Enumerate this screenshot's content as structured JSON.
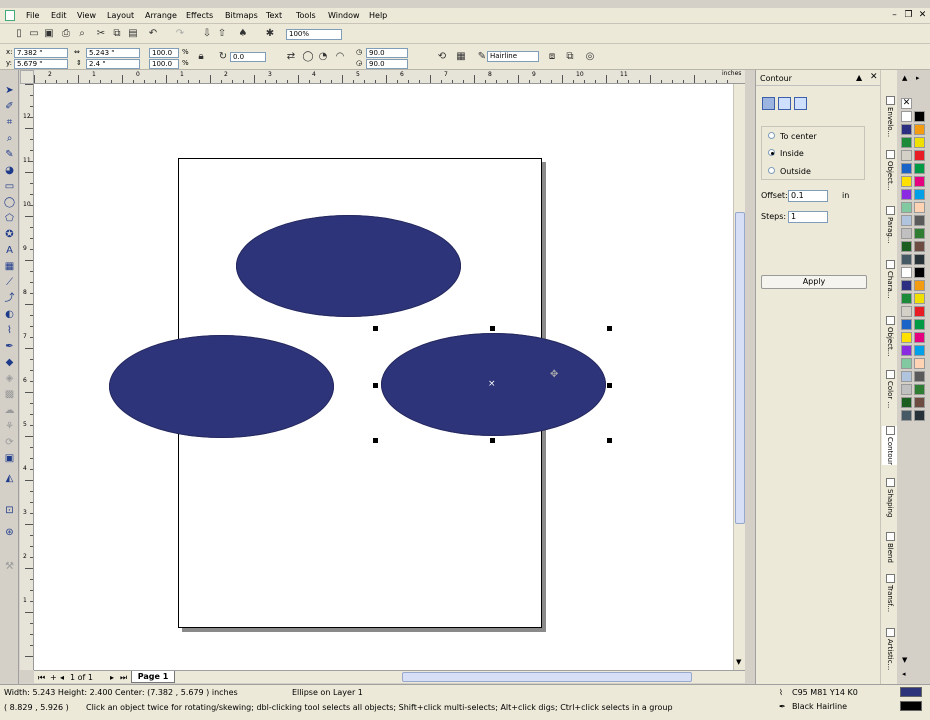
{
  "menu": [
    "File",
    "Edit",
    "View",
    "Layout",
    "Arrange",
    "Effects",
    "Bitmaps",
    "Text",
    "Tools",
    "Window",
    "Help"
  ],
  "toolbar": {
    "zoom": "100%"
  },
  "property_bar": {
    "x": "7.382 \"",
    "y": "5.679 \"",
    "width": "5.243 \"",
    "height": "2.4 \"",
    "scale_x": "100.0",
    "scale_y": "100.0",
    "percent": "%",
    "rotation": "0.0",
    "angle_start": "90.0",
    "angle_end": "90.0",
    "outline": "Hairline",
    "x_label": "x:",
    "y_label": "y:"
  },
  "rulers": {
    "h_unit": "inches",
    "h_ticks": [
      "2",
      "1",
      "0",
      "1",
      "2",
      "3",
      "4",
      "5",
      "6",
      "7",
      "8",
      "9",
      "10",
      "11"
    ],
    "v_ticks": [
      "12",
      "11",
      "10",
      "9",
      "8",
      "7",
      "6",
      "5",
      "4",
      "3",
      "2",
      "1"
    ]
  },
  "pagebar": {
    "count": "1 of 1",
    "tab": "Page 1"
  },
  "docker": {
    "title": "Contour",
    "options": [
      "To center",
      "Inside",
      "Outside"
    ],
    "selected": "Inside",
    "offset_label": "Offset:",
    "offset_value": "0.1",
    "offset_unit": "in",
    "steps_label": "Steps:",
    "steps_value": "1",
    "apply": "Apply"
  },
  "dock_tabs": [
    "Envelo...",
    "Object...",
    "Parag...",
    "Chara...",
    "Object...",
    "Color ...",
    "Contour",
    "Shaping",
    "Blend",
    "Transf...",
    "Artistic..."
  ],
  "colors": {
    "ellipse_fill": "#2e3479",
    "palette": [
      "#ffffff",
      "#000000",
      "#2c2e82",
      "#f39c12",
      "#1d8a3a",
      "#f0e000",
      "#d4d0c8",
      "#e81c24",
      "#1a64c8",
      "#009944",
      "#ffe100",
      "#e4007f",
      "#8a2be2",
      "#00a0e9",
      "#82c8a0",
      "#ffd3b4",
      "#b0c4de",
      "#5a5a5a",
      "#c0c0c0",
      "#2e7d32",
      "#1b5e20",
      "#6d4c41",
      "#455a64",
      "#263238"
    ]
  },
  "status": {
    "dims": "Width: 5.243  Height: 2.400  Center: (7.382 , 5.679 )  inches",
    "layer": "Ellipse on Layer 1",
    "coords": "( 8.829 , 5.926 )",
    "hint": "Click an object twice for rotating/skewing; dbl-clicking tool selects all objects; Shift+click multi-selects; Alt+click digs; Ctrl+click selects in a group",
    "fill": "C95 M81 Y14 K0",
    "outline": "Black  Hairline"
  }
}
